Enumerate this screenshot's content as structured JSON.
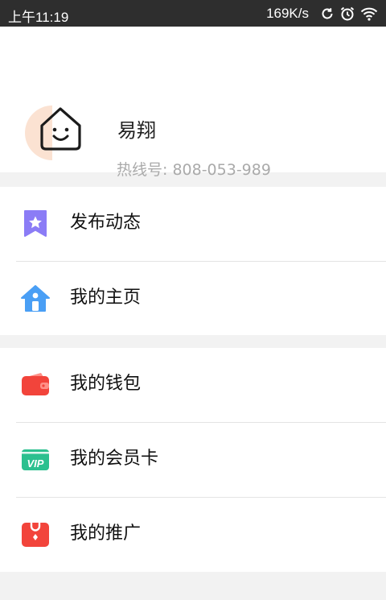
{
  "status_bar": {
    "time": "上午11:19",
    "speed": "169K/s",
    "icons": [
      "sync-icon",
      "alarm-icon",
      "wifi-icon"
    ]
  },
  "profile": {
    "name": "易翔",
    "hotline": "热线号: 808-053-989",
    "avatar_icon": "smiling-house-icon"
  },
  "menu_groups": [
    {
      "items": [
        {
          "label": "发布动态",
          "icon": "star-bookmark-icon",
          "color": "#8b7cf6"
        },
        {
          "label": "我的主页",
          "icon": "home-icon",
          "color": "#4a9ff5"
        }
      ]
    },
    {
      "items": [
        {
          "label": "我的钱包",
          "icon": "wallet-icon",
          "color": "#f2443b"
        },
        {
          "label": "我的会员卡",
          "icon": "vip-card-icon",
          "color": "#2bc08f"
        },
        {
          "label": "我的推广",
          "icon": "promotion-bag-icon",
          "color": "#f2443b"
        }
      ]
    }
  ]
}
